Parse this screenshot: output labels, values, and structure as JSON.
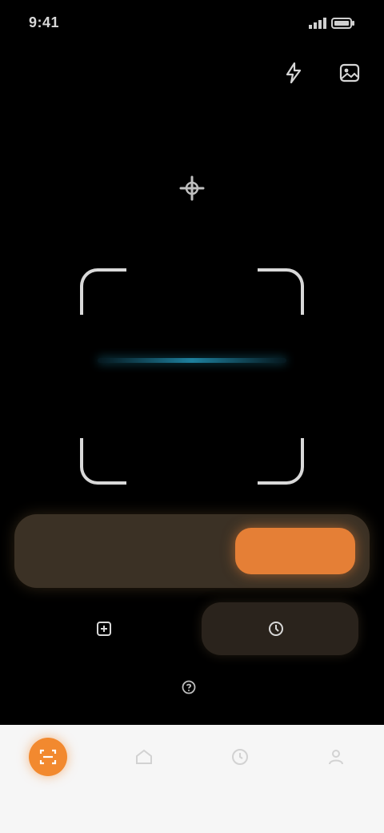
{
  "status_bar": {
    "time": "9:41",
    "signal_icon": "signal-icon",
    "battery_icon": "battery-icon"
  },
  "toolbar": {
    "flash_icon": "flash-icon",
    "gallery_icon": "gallery-icon"
  },
  "scanner": {
    "hint_icon": "scan-hint-icon",
    "hint_text": "",
    "frame_color": "#d9d9d9",
    "scan_line_color": "#1e7f9d"
  },
  "mode_toggle": {
    "options": [
      "",
      ""
    ],
    "active_index": 1,
    "accent": "#e57f36"
  },
  "actions": {
    "left_label": "",
    "right_label": ""
  },
  "help": {
    "label": ""
  },
  "bottom_nav": {
    "items": [
      {
        "label": "",
        "icon": "scan-icon",
        "active": true
      },
      {
        "label": "",
        "icon": "home-icon",
        "active": false
      },
      {
        "label": "",
        "icon": "history-icon",
        "active": false
      },
      {
        "label": "",
        "icon": "profile-icon",
        "active": false
      }
    ]
  }
}
